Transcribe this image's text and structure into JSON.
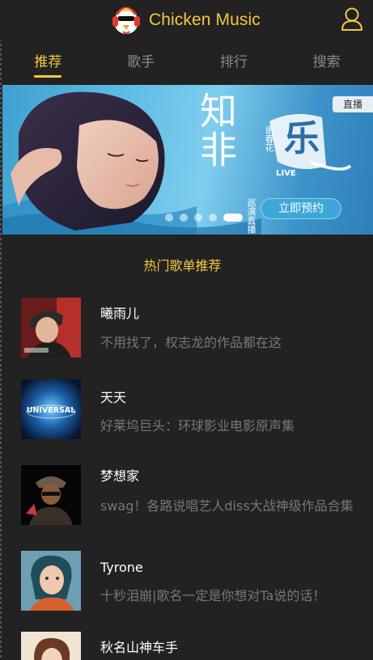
{
  "header": {
    "app_title": "Chicken Music",
    "logo_icon": "chicken-headphones-logo",
    "user_icon": "user-icon",
    "accent_color": "#f3c843"
  },
  "tabs": [
    {
      "label": "推荐",
      "active": true
    },
    {
      "label": "歌手",
      "active": false
    },
    {
      "label": "排行",
      "active": false
    },
    {
      "label": "搜索",
      "active": false
    }
  ],
  "banner": {
    "live_tag": "直播",
    "title_text": "知非",
    "artist_text": "谢春花",
    "tour_text": "巡演直播",
    "logo_text": "乐",
    "live_badge": "LIVE",
    "cta_label": "立即预约",
    "dots_count": 5,
    "active_dot": 4
  },
  "section_title": "热门歌单推荐",
  "playlists": [
    {
      "name": "曦雨儿",
      "desc": "不用找了，权志龙的作品都在这"
    },
    {
      "name": "天天",
      "desc": "好莱坞巨头：环球影业电影原声集",
      "thumb_text": "UNIVERSAL"
    },
    {
      "name": "梦想家",
      "desc": "swag！各路说唱艺人diss大战神级作品合集"
    },
    {
      "name": "Tyrone",
      "desc": "十秒泪崩|歌名一定是你想对Ta说的话！"
    },
    {
      "name": "秋名山神车手",
      "desc": ""
    }
  ]
}
